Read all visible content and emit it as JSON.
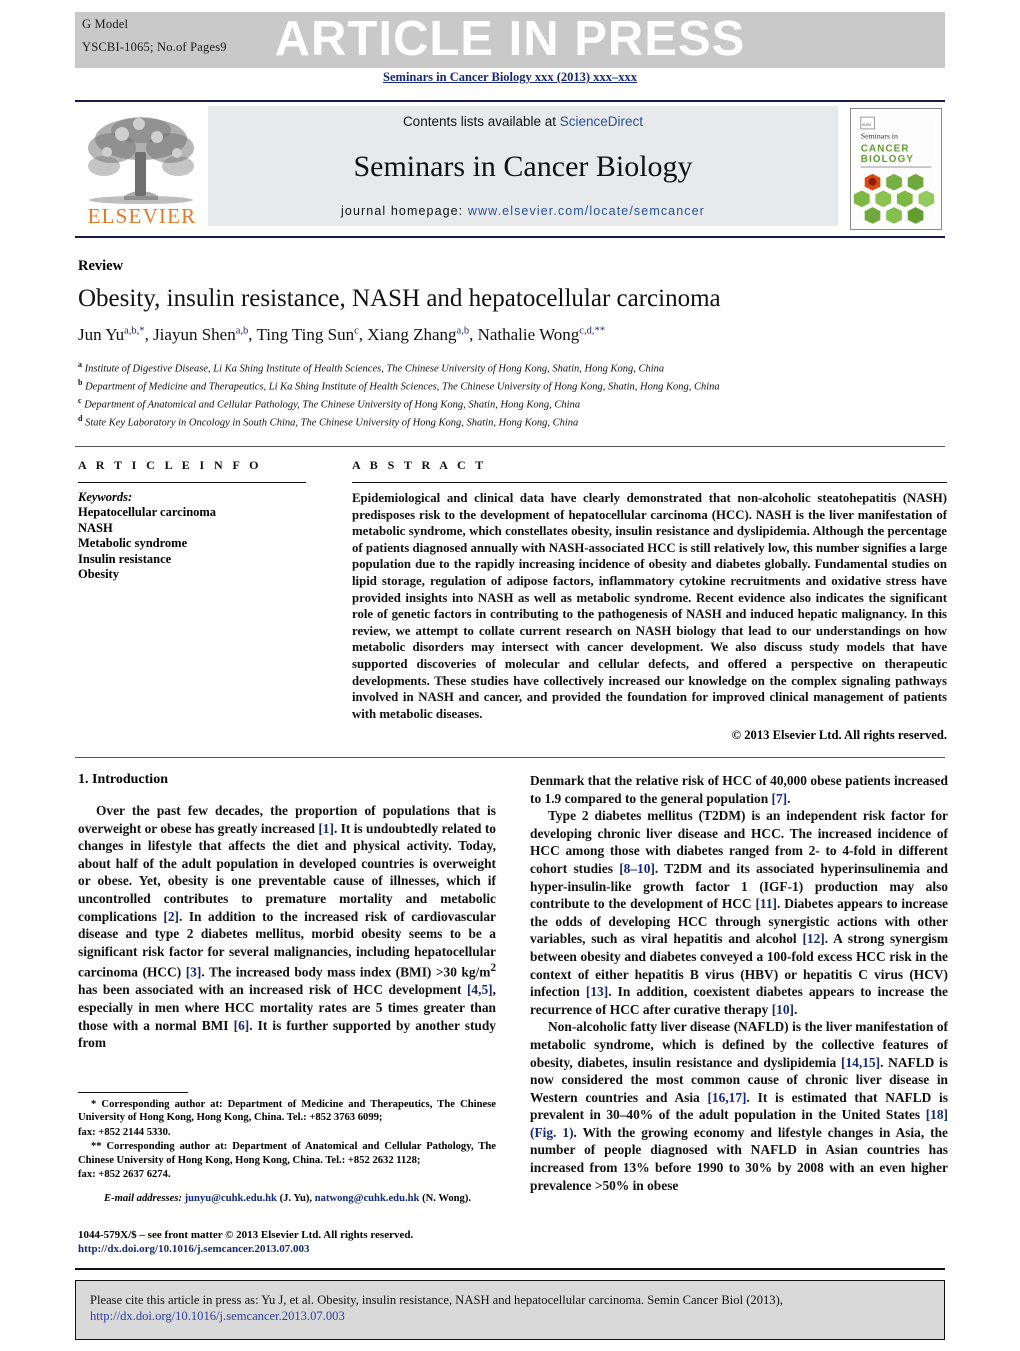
{
  "header": {
    "g_model": "G Model",
    "article_id": "YSCBI-1065;   No.of Pages9",
    "banner": "ARTICLE IN PRESS",
    "running_head": "Seminars in Cancer Biology xxx (2013) xxx–xxx"
  },
  "masthead": {
    "contents_prefix": "Contents lists available at ",
    "sciencedirect": "ScienceDirect",
    "journal_title": "Seminars in Cancer Biology",
    "homepage_label": "journal homepage:",
    "homepage_url": "www.elsevier.com/locate/semcancer",
    "publisher": "ELSEVIER",
    "cover_line1": "Seminars in",
    "cover_line2": "CANCER",
    "cover_line3": "BIOLOGY"
  },
  "article": {
    "type": "Review",
    "title": "Obesity, insulin resistance, NASH and hepatocellular carcinoma",
    "authors_html": "Jun Yu<sup>a,b,*</sup>, Jiayun Shen<sup>a,b</sup>, Ting Ting Sun<sup>c</sup>, Xiang Zhang<sup>a,b</sup>, Nathalie Wong<sup>c,d,**</sup>",
    "affiliations": [
      {
        "marker": "a",
        "text": "Institute of Digestive Disease, Li Ka Shing Institute of Health Sciences, The Chinese University of Hong Kong, Shatin, Hong Kong, China"
      },
      {
        "marker": "b",
        "text": "Department of Medicine and Therapeutics, Li Ka Shing Institute of Health Sciences, The Chinese University of Hong Kong, Shatin, Hong Kong, China"
      },
      {
        "marker": "c",
        "text": "Department of Anatomical and Cellular Pathology, The Chinese University of Hong Kong, Shatin, Hong Kong, China"
      },
      {
        "marker": "d",
        "text": "State Key Laboratory in Oncology in South China, The Chinese University of Hong Kong, Shatin, Hong Kong, China"
      }
    ]
  },
  "info": {
    "heading": "A R T I C L E   I N F O",
    "keywords_label": "Keywords:",
    "keywords": [
      "Hepatocellular carcinoma",
      "NASH",
      "Metabolic syndrome",
      "Insulin resistance",
      "Obesity"
    ]
  },
  "abstract": {
    "heading": "A B S T R A C T",
    "body": "Epidemiological and clinical data have clearly demonstrated that non-alcoholic steatohepatitis (NASH) predisposes risk to the development of hepatocellular carcinoma (HCC). NASH is the liver manifestation of metabolic syndrome, which constellates obesity, insulin resistance and dyslipidemia. Although the percentage of patients diagnosed annually with NASH-associated HCC is still relatively low, this number signifies a large population due to the rapidly increasing incidence of obesity and diabetes globally. Fundamental studies on lipid storage, regulation of adipose factors, inflammatory cytokine recruitments and oxidative stress have provided insights into NASH as well as metabolic syndrome. Recent evidence also indicates the significant role of genetic factors in contributing to the pathogenesis of NASH and induced hepatic malignancy. In this review, we attempt to collate current research on NASH biology that lead to our understandings on how metabolic disorders may intersect with cancer development. We also discuss study models that have supported discoveries of molecular and cellular defects, and offered a perspective on therapeutic developments. These studies have collectively increased our knowledge on the complex signaling pathways involved in NASH and cancer, and provided the foundation for improved clinical management of patients with metabolic diseases.",
    "copyright": "© 2013 Elsevier Ltd. All rights reserved."
  },
  "body": {
    "section_heading": "1.  Introduction",
    "left_paragraphs": [
      "Over the past few decades, the proportion of populations that is overweight or obese has greatly increased [1]. It is undoubtedly related to changes in lifestyle that affects the diet and physical activity. Today, about half of the adult population in developed countries is overweight or obese. Yet, obesity is one preventable cause of illnesses, which if uncontrolled contributes to premature mortality and metabolic complications [2]. In addition to the increased risk of cardiovascular disease and type 2 diabetes mellitus, morbid obesity seems to be a significant risk factor for several malignancies, including hepatocellular carcinoma (HCC) [3]. The increased body mass index (BMI) >30 kg/m2 has been associated with an increased risk of HCC development [4,5], especially in men where HCC mortality rates are 5 times greater than those with a normal BMI [6]. It is further supported by another study from"
    ],
    "right_paragraphs": [
      "Denmark that the relative risk of HCC of 40,000 obese patients increased to 1.9 compared to the general population [7].",
      "Type 2 diabetes mellitus (T2DM) is an independent risk factor for developing chronic liver disease and HCC. The increased incidence of HCC among those with diabetes ranged from 2- to 4-fold in different cohort studies [8–10]. T2DM and its associated hyperinsulinemia and hyper-insulin-like growth factor 1 (IGF-1) production may also contribute to the development of HCC [11]. Diabetes appears to increase the odds of developing HCC through synergistic actions with other variables, such as viral hepatitis and alcohol [12]. A strong synergism between obesity and diabetes conveyed a 100-fold excess HCC risk in the context of either hepatitis B virus (HBV) or hepatitis C virus (HCV) infection [13]. In addition, coexistent diabetes appears to increase the recurrence of HCC after curative therapy [10].",
      "Non-alcoholic fatty liver disease (NAFLD) is the liver manifestation of metabolic syndrome, which is defined by the collective features of obesity, diabetes, insulin resistance and dyslipidemia [14,15]. NAFLD is now considered the most common cause of chronic liver disease in Western countries and Asia [16,17]. It is estimated that NAFLD is prevalent in 30–40% of the adult population in the United States [18] (Fig. 1). With the growing economy and lifestyle changes in Asia, the number of people diagnosed with NAFLD in Asian countries has increased from 13% before 1990 to 30% by 2008 with an even higher prevalence >50% in obese"
    ]
  },
  "footnotes": {
    "star": "* Corresponding author at: Department of Medicine and Therapeutics, The Chinese University of Hong Kong, Hong Kong, China. Tel.: +852 3763 6099;",
    "star_fax": "fax: +852 2144 5330.",
    "doublestar": "** Corresponding author at: Department of Anatomical and Cellular Pathology, The Chinese University of Hong Kong, Hong Kong, China. Tel.: +852 2632 1128;",
    "doublestar_fax": "fax: +852 2637 6274.",
    "email_label": "E-mail addresses:",
    "email1": "junyu@cuhk.edu.hk",
    "email1_owner": "(J. Yu),",
    "email2": "natwong@cuhk.edu.hk",
    "email2_owner": "(N. Wong)."
  },
  "imprint": {
    "issn_line": "1044-579X/$ – see front matter © 2013 Elsevier Ltd. All rights reserved.",
    "doi_line": "http://dx.doi.org/10.1016/j.semcancer.2013.07.003"
  },
  "cite_box": {
    "line1": "Please cite this article in press as: Yu J, et al. Obesity, insulin resistance, NASH and hepatocellular carcinoma. Semin Cancer Biol (2013),",
    "line2": "http://dx.doi.org/10.1016/j.semcancer.2013.07.003"
  },
  "colors": {
    "banner_bg": "#c9c9c9",
    "link_blue": "#13287a",
    "sciencedirect_blue": "#2352a0",
    "elsevier_orange": "#E87722",
    "cite_box_bg": "#d9d9d9"
  }
}
